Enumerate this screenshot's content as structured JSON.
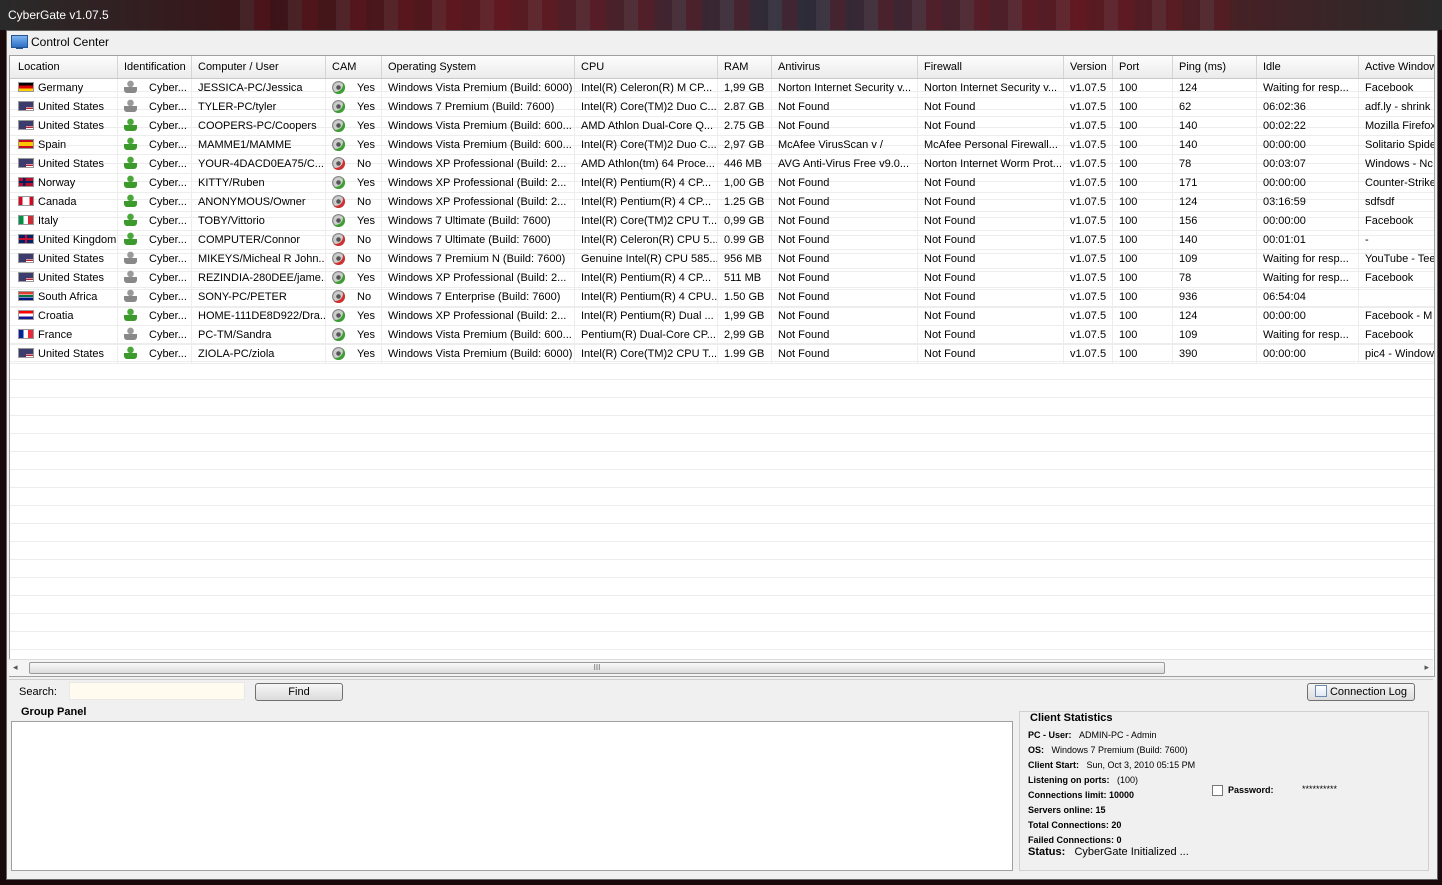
{
  "window": {
    "title": "CyberGate v1.07.5",
    "panel_title": "Control Center"
  },
  "columns": [
    "Location",
    "Identification",
    "Computer / User",
    "CAM",
    "Operating System",
    "CPU",
    "RAM",
    "Antivirus",
    "Firewall",
    "Version",
    "Port",
    "Ping (ms)",
    "Idle",
    "Active Window"
  ],
  "rows": [
    {
      "flag": "germany",
      "location": "Germany",
      "id": "Cyber...",
      "id_icon": "gray",
      "user": "JESSICA-PC/Jessica",
      "cam": "Yes",
      "os": "Windows Vista Premium (Build: 6000)",
      "cpu": "Intel(R) Celeron(R) M CP...",
      "ram": "1,99 GB",
      "av": "Norton Internet Security v...",
      "fw": "Norton Internet Security v...",
      "ver": "v1.07.5",
      "port": "100",
      "ping": "124",
      "idle": "Waiting for resp...",
      "active": "Facebook"
    },
    {
      "flag": "usa",
      "location": "United States",
      "id": "Cyber...",
      "id_icon": "gray",
      "user": "TYLER-PC/tyler",
      "cam": "Yes",
      "os": "Windows 7 Premium (Build: 7600)",
      "cpu": "Intel(R) Core(TM)2 Duo C...",
      "ram": "2.87 GB",
      "av": "Not Found",
      "fw": "Not Found",
      "ver": "v1.07.5",
      "port": "100",
      "ping": "62",
      "idle": "06:02:36",
      "active": "adf.ly - shrink"
    },
    {
      "flag": "usa",
      "location": "United States",
      "id": "Cyber...",
      "id_icon": "green",
      "user": "COOPERS-PC/Coopers",
      "cam": "Yes",
      "os": "Windows Vista Premium (Build: 600...",
      "cpu": "AMD Athlon Dual-Core Q...",
      "ram": "2.75 GB",
      "av": "Not Found",
      "fw": "Not Found",
      "ver": "v1.07.5",
      "port": "100",
      "ping": "140",
      "idle": "00:02:22",
      "active": "Mozilla Firefox"
    },
    {
      "flag": "spain",
      "location": "Spain",
      "id": "Cyber...",
      "id_icon": "green",
      "user": "MAMME1/MAMME",
      "cam": "Yes",
      "os": "Windows Vista Premium (Build: 600...",
      "cpu": "Intel(R) Core(TM)2 Duo C...",
      "ram": "2,97 GB",
      "av": "McAfee VirusScan v /",
      "fw": "McAfee Personal Firewall...",
      "ver": "v1.07.5",
      "port": "100",
      "ping": "140",
      "idle": "00:00:00",
      "active": "Solitario Spide"
    },
    {
      "flag": "usa",
      "location": "United States",
      "id": "Cyber...",
      "id_icon": "green",
      "user": "YOUR-4DACD0EA75/C...",
      "cam": "No",
      "os": "Windows XP Professional (Build: 2...",
      "cpu": "AMD Athlon(tm) 64 Proce...",
      "ram": "446 MB",
      "av": "AVG Anti-Virus Free v9.0...",
      "fw": "Norton Internet Worm Prot...",
      "ver": "v1.07.5",
      "port": "100",
      "ping": "78",
      "idle": "00:03:07",
      "active": "Windows - Nc"
    },
    {
      "flag": "norway",
      "location": "Norway",
      "id": "Cyber...",
      "id_icon": "green",
      "user": "KITTY/Ruben",
      "cam": "Yes",
      "os": "Windows XP Professional (Build: 2...",
      "cpu": "Intel(R) Pentium(R) 4 CP...",
      "ram": "1,00 GB",
      "av": "Not Found",
      "fw": "Not Found",
      "ver": "v1.07.5",
      "port": "100",
      "ping": "171",
      "idle": "00:00:00",
      "active": "Counter-Strike"
    },
    {
      "flag": "canada",
      "location": "Canada",
      "id": "Cyber...",
      "id_icon": "green",
      "user": "ANONYMOUS/Owner",
      "cam": "No",
      "os": "Windows XP Professional (Build: 2...",
      "cpu": "Intel(R) Pentium(R) 4 CP...",
      "ram": "1.25 GB",
      "av": "Not Found",
      "fw": "Not Found",
      "ver": "v1.07.5",
      "port": "100",
      "ping": "124",
      "idle": "03:16:59",
      "active": "sdfsdf"
    },
    {
      "flag": "italy",
      "location": "Italy",
      "id": "Cyber...",
      "id_icon": "green",
      "user": "TOBY/Vittorio",
      "cam": "Yes",
      "os": "Windows 7 Ultimate (Build: 7600)",
      "cpu": "Intel(R) Core(TM)2 CPU T...",
      "ram": "0,99 GB",
      "av": "Not Found",
      "fw": "Not Found",
      "ver": "v1.07.5",
      "port": "100",
      "ping": "156",
      "idle": "00:00:00",
      "active": "Facebook"
    },
    {
      "flag": "uk",
      "location": "United Kingdom",
      "id": "Cyber...",
      "id_icon": "green",
      "user": "COMPUTER/Connor",
      "cam": "No",
      "os": "Windows 7 Ultimate (Build: 7600)",
      "cpu": "Intel(R) Celeron(R) CPU 5...",
      "ram": "0.99 GB",
      "av": "Not Found",
      "fw": "Not Found",
      "ver": "v1.07.5",
      "port": "100",
      "ping": "140",
      "idle": "00:01:01",
      "active": "-"
    },
    {
      "flag": "usa",
      "location": "United States",
      "id": "Cyber...",
      "id_icon": "gray",
      "user": "MIKEYS/Micheal R John...",
      "cam": "No",
      "os": "Windows 7 Premium N (Build: 7600)",
      "cpu": "Genuine Intel(R) CPU 585...",
      "ram": "956 MB",
      "av": "Not Found",
      "fw": "Not Found",
      "ver": "v1.07.5",
      "port": "100",
      "ping": "109",
      "idle": "Waiting for resp...",
      "active": "YouTube - Tee"
    },
    {
      "flag": "usa",
      "location": "United States",
      "id": "Cyber...",
      "id_icon": "gray",
      "user": "REZINDIA-280DEE/jame...",
      "cam": "Yes",
      "os": "Windows XP Professional (Build: 2...",
      "cpu": "Intel(R) Pentium(R) 4 CP...",
      "ram": "511 MB",
      "av": "Not Found",
      "fw": "Not Found",
      "ver": "v1.07.5",
      "port": "100",
      "ping": "78",
      "idle": "Waiting for resp...",
      "active": "Facebook"
    },
    {
      "flag": "southafrica",
      "location": "South Africa",
      "id": "Cyber...",
      "id_icon": "gray",
      "user": "SONY-PC/PETER",
      "cam": "No",
      "os": "Windows 7 Enterprise (Build: 7600)",
      "cpu": "Intel(R) Pentium(R) 4 CPU...",
      "ram": "1.50 GB",
      "av": "Not Found",
      "fw": "Not Found",
      "ver": "v1.07.5",
      "port": "100",
      "ping": "936",
      "idle": "06:54:04",
      "active": ""
    },
    {
      "flag": "croatia",
      "location": "Croatia",
      "id": "Cyber...",
      "id_icon": "green",
      "user": "HOME-111DE8D922/Dra...",
      "cam": "Yes",
      "os": "Windows XP Professional (Build: 2...",
      "cpu": "Intel(R) Pentium(R) Dual ...",
      "ram": "1,99 GB",
      "av": "Not Found",
      "fw": "Not Found",
      "ver": "v1.07.5",
      "port": "100",
      "ping": "124",
      "idle": "00:00:00",
      "active": "Facebook - M"
    },
    {
      "flag": "france",
      "location": "France",
      "id": "Cyber...",
      "id_icon": "gray",
      "user": "PC-TM/Sandra",
      "cam": "Yes",
      "os": "Windows Vista Premium (Build: 600...",
      "cpu": "Pentium(R) Dual-Core CP...",
      "ram": "2,99 GB",
      "av": "Not Found",
      "fw": "Not Found",
      "ver": "v1.07.5",
      "port": "100",
      "ping": "109",
      "idle": "Waiting for resp...",
      "active": "Facebook"
    },
    {
      "flag": "usa",
      "location": "United States",
      "id": "Cyber...",
      "id_icon": "green",
      "user": "ZIOLA-PC/ziola",
      "cam": "Yes",
      "os": "Windows Vista Premium (Build: 6000)",
      "cpu": "Intel(R) Core(TM)2 CPU T...",
      "ram": "1.99 GB",
      "av": "Not Found",
      "fw": "Not Found",
      "ver": "v1.07.5",
      "port": "100",
      "ping": "390",
      "idle": "00:00:00",
      "active": "pic4 - Window"
    }
  ],
  "scrollbar": {
    "grip": "III",
    "left_arrow": "◂",
    "right_arrow": "▸"
  },
  "search": {
    "label": "Search:",
    "value": "",
    "find_label": "Find",
    "log_label": "Connection Log"
  },
  "group_panel": {
    "title": "Group Panel"
  },
  "stats": {
    "title": "Client Statistics",
    "pc_user_label": "PC - User:",
    "pc_user": "ADMIN-PC - Admin",
    "os_label": "OS:",
    "os": "Windows 7 Premium (Build: 7600)",
    "client_start_label": "Client Start:",
    "client_start": "Sun, Oct 3, 2010     05:15 PM",
    "listening_label": "Listening on ports:",
    "listening": "(100)",
    "conn_limit": "Connections limit: 10000",
    "password_label": "Password:",
    "password": "**********",
    "servers_online": "Servers online: 15",
    "total_connections": "Total Connections: 20",
    "failed_connections": "Failed Connections: 0",
    "status_label": "Status:",
    "status": "CyberGate Initialized ..."
  },
  "flag_colors": {
    "germany": "linear-gradient(#000 0 33%,#dd0000 33% 66%,#ffce00 66%)",
    "usa": "repeating-linear-gradient(#b22234 0 1.4px,#fff 1.4px 2.8px)",
    "spain": "linear-gradient(#c60b1e 0 25%,#ffc400 25% 75%,#c60b1e 75%)",
    "norway": "linear-gradient(90deg,transparent 30%,#00205b 30% 45%,transparent 45%),linear-gradient(transparent 35%,#00205b 35% 65%,transparent 65%),#ba0c2f",
    "canada": "linear-gradient(90deg,#d80621 0 25%,#fff 25% 75%,#d80621 75%)",
    "italy": "linear-gradient(90deg,#009246 0 33%,#fff 33% 66%,#ce2b37 66%)",
    "uk": "linear-gradient(90deg,transparent 42%,#c8102e 42% 58%,transparent 58%),linear-gradient(transparent 38%,#c8102e 38% 62%,transparent 62%),#012169",
    "southafrica": "linear-gradient(#e03c31 0 33%,#fff 33% 38%,#007749 38% 62%,#fff 62% 67%,#001489 67%)",
    "croatia": "linear-gradient(#ff0000 0 33%,#fff 33% 66%,#171796 66%)",
    "france": "linear-gradient(90deg,#002395 0 33%,#fff 33% 66%,#ed2939 66%)"
  }
}
